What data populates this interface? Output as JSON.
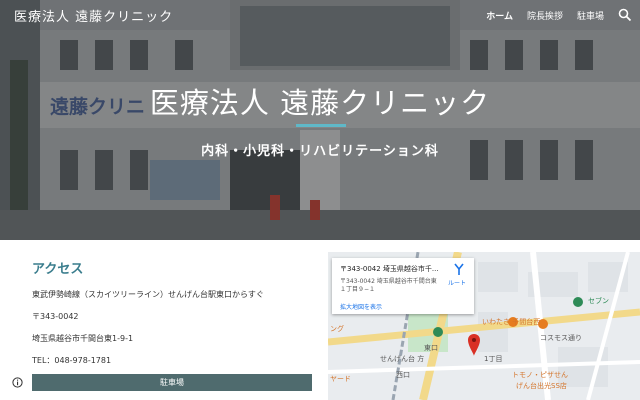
{
  "header": {
    "site_title": "医療法人 遠藤クリニック",
    "nav": [
      {
        "label": "ホーム",
        "active": true
      },
      {
        "label": "院長挨拶",
        "active": false
      },
      {
        "label": "駐車場",
        "active": false
      }
    ]
  },
  "hero": {
    "title": "医療法人 遠藤クリニック",
    "subtitle": "内科・小児科・リハビリテーション科",
    "building_sign": "遠藤クリニ"
  },
  "access": {
    "title": "アクセス",
    "train": "東武伊勢崎線（スカイツリーライン）せんげん台駅東口からすぐ",
    "postal": "〒343-0042",
    "address": "埼玉県越谷市千間台東1-9-1",
    "phone": "TEL：048-978-1781",
    "parking_button": "駐車場"
  },
  "map": {
    "card_title": "〒343-0042 埼玉県越谷市千...",
    "card_address": "〒343-0042 埼玉県越谷市千間台東１丁目９−１",
    "enlarge_link": "拡大地図を表示",
    "route_label": "ルート",
    "labels": {
      "iwatani": "いわたき 千間台西",
      "cosmos": "コスモス通り",
      "sengendai": "せんげん台 方",
      "chome": "1丁目",
      "seven": "セブン",
      "tomin": "トモノ・ピザせん",
      "gas": "げん台出光SS店",
      "higashi": "東口",
      "nishi": "西口",
      "ring": "ング",
      "yard": "ヤード"
    }
  },
  "colors": {
    "accent_teal": "#3a7d8d",
    "rule": "#5fb8c8",
    "button": "#4f6b6e",
    "map_road_yellow": "#f2d98a",
    "map_pin": "#d93025"
  }
}
